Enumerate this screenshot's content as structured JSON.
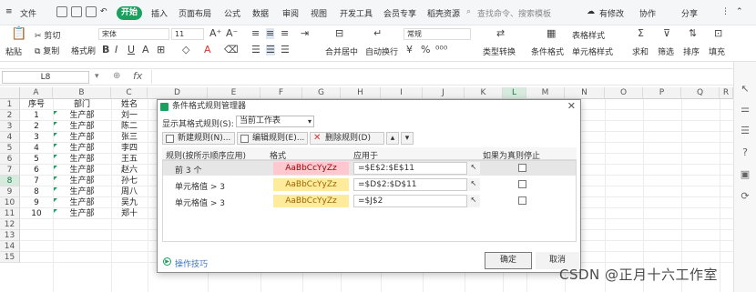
{
  "menubar": {
    "file": "文件",
    "start": "开始",
    "tabs": [
      "插入",
      "页面布局",
      "公式",
      "数据",
      "审阅",
      "视图",
      "开发工具",
      "会员专享",
      "稻壳资源"
    ],
    "search_placeholder": "查找命令、搜索模板",
    "has_changes": "有修改",
    "collab": "协作",
    "share": "分享"
  },
  "ribbon": {
    "paste": "粘贴",
    "cut": "剪切",
    "copy": "复制",
    "format_painter": "格式刷",
    "font": "宋体",
    "font_size": "11",
    "merge": "合并居中",
    "wrap": "自动换行",
    "number_format": "常规",
    "type_convert": "类型转换",
    "cond_format": "条件格式",
    "table_style": "表格样式",
    "cell_style": "单元格样式",
    "sum": "求和",
    "filter": "筛选",
    "sort": "排序",
    "fill": "填充"
  },
  "formula_bar": {
    "name_box": "L8",
    "fx": "fx"
  },
  "sheet": {
    "columns": [
      "A",
      "B",
      "C",
      "D",
      "E",
      "F",
      "G",
      "H",
      "I",
      "J",
      "K",
      "L",
      "M",
      "N",
      "O",
      "P",
      "Q",
      "R"
    ],
    "rows": [
      "1",
      "2",
      "3",
      "4",
      "5",
      "6",
      "7",
      "8",
      "9",
      "10",
      "11",
      "12",
      "13",
      "14",
      "15"
    ],
    "header_row": {
      "a": "序号",
      "b": "部门",
      "c": "姓名"
    },
    "data": [
      {
        "a": "1",
        "b": "生产部",
        "c": "刘一"
      },
      {
        "a": "2",
        "b": "生产部",
        "c": "陈二"
      },
      {
        "a": "3",
        "b": "生产部",
        "c": "张三"
      },
      {
        "a": "4",
        "b": "生产部",
        "c": "李四"
      },
      {
        "a": "5",
        "b": "生产部",
        "c": "王五"
      },
      {
        "a": "6",
        "b": "生产部",
        "c": "赵六"
      },
      {
        "a": "7",
        "b": "生产部",
        "c": "孙七"
      },
      {
        "a": "8",
        "b": "生产部",
        "c": "周八"
      },
      {
        "a": "9",
        "b": "生产部",
        "c": "吴九"
      },
      {
        "a": "10",
        "b": "生产部",
        "c": "郑十"
      }
    ]
  },
  "dialog": {
    "title": "条件格式规则管理器",
    "show_label": "显示其格式规则(S):",
    "show_value": "当前工作表",
    "new_rule": "新建规则(N)...",
    "edit_rule": "编辑规则(E)...",
    "delete_rule": "删除规则(D)",
    "col_rule": "规则(按所示顺序应用)",
    "col_format": "格式",
    "col_applies": "应用于",
    "col_stop": "如果为真则停止",
    "rules": [
      {
        "name": "前 3 个",
        "preview": "AaBbCcYyZz",
        "applies": "=$E$2:$E$11",
        "bg": "#ffc7ce",
        "fg": "#9c0006"
      },
      {
        "name": "单元格值 > 3",
        "preview": "AaBbCcYyZz",
        "applies": "=$D$2:$D$11",
        "bg": "#ffeb9c",
        "fg": "#9c6500"
      },
      {
        "name": "单元格值 > 3",
        "preview": "AaBbCcYyZz",
        "applies": "=$J$2",
        "bg": "#ffeb9c",
        "fg": "#9c6500"
      }
    ],
    "tips": "操作技巧",
    "ok": "确定",
    "cancel": "取消"
  },
  "watermark": "CSDN @正月十六工作室"
}
